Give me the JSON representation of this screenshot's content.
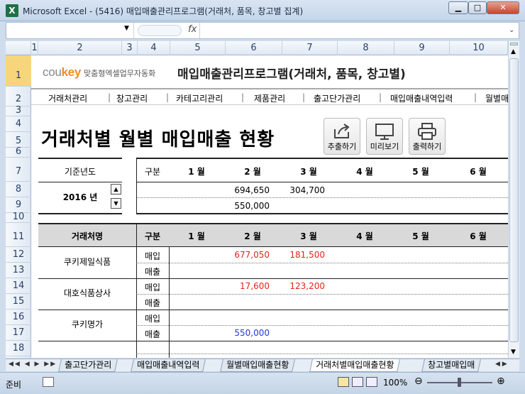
{
  "window": {
    "title": "Microsoft Excel - (5416) 매입매출관리프로그램(거래처, 품목, 창고별 집계)"
  },
  "formula_bar": {
    "fx": "fx",
    "name_box": "",
    "content": ""
  },
  "columns": [
    "1",
    "2",
    "3",
    "4",
    "5",
    "6",
    "7",
    "8",
    "9",
    "10"
  ],
  "rows": [
    "1",
    "2",
    "3",
    "4",
    "5",
    "6",
    "7",
    "8",
    "9",
    "10",
    "11",
    "12",
    "13",
    "14",
    "15",
    "16",
    "17",
    "18"
  ],
  "brand": {
    "logo_a": "cou",
    "logo_b": "key",
    "tagline": "맞춤형엑셀업무자동화",
    "app_title": "매입매출관리프로그램(거래처, 품목, 창고별)"
  },
  "nav": [
    "거래처관리",
    "창고관리",
    "카테고리관리",
    "제품관리",
    "출고단가관리",
    "매입매출내역입력",
    "월별매"
  ],
  "report_title": "거래처별 월별 매입매출 현황",
  "buttons": {
    "export": "추출하기",
    "preview": "미리보기",
    "print": "출력하기"
  },
  "summary": {
    "year_label": "기준년도",
    "year_value": "2016 년",
    "gubun": "구분",
    "months": [
      "1 월",
      "2 월",
      "3 월",
      "4 월",
      "5 월",
      "6 월"
    ],
    "purchase_row": [
      "",
      "694,650",
      "304,700",
      "",
      "",
      ""
    ],
    "sales_row": [
      "",
      "550,000",
      "",
      "",
      "",
      ""
    ]
  },
  "detail": {
    "col_client": "거래처명",
    "col_gubun": "구분",
    "months": [
      "1 월",
      "2 월",
      "3 월",
      "4 월",
      "5 월",
      "6 월"
    ],
    "buy": "매입",
    "sell": "매출",
    "clients": [
      {
        "name": "쿠키제일식품",
        "buy": [
          "",
          "677,050",
          "181,500"
        ],
        "sell": [
          "",
          "",
          ""
        ]
      },
      {
        "name": "대호식품상사",
        "buy": [
          "",
          "17,600",
          "123,200"
        ],
        "sell": [
          "",
          "",
          ""
        ]
      },
      {
        "name": "쿠키명가",
        "buy": [
          "",
          "",
          ""
        ],
        "sell": [
          "",
          "550,000",
          ""
        ]
      }
    ]
  },
  "sheet_tabs": [
    "출고단가관리",
    "매입매출내역입력",
    "월별매입매출현황",
    "거래처별매입매출현황",
    "창고별매입매"
  ],
  "status": {
    "ready": "준비",
    "zoom": "100%"
  }
}
